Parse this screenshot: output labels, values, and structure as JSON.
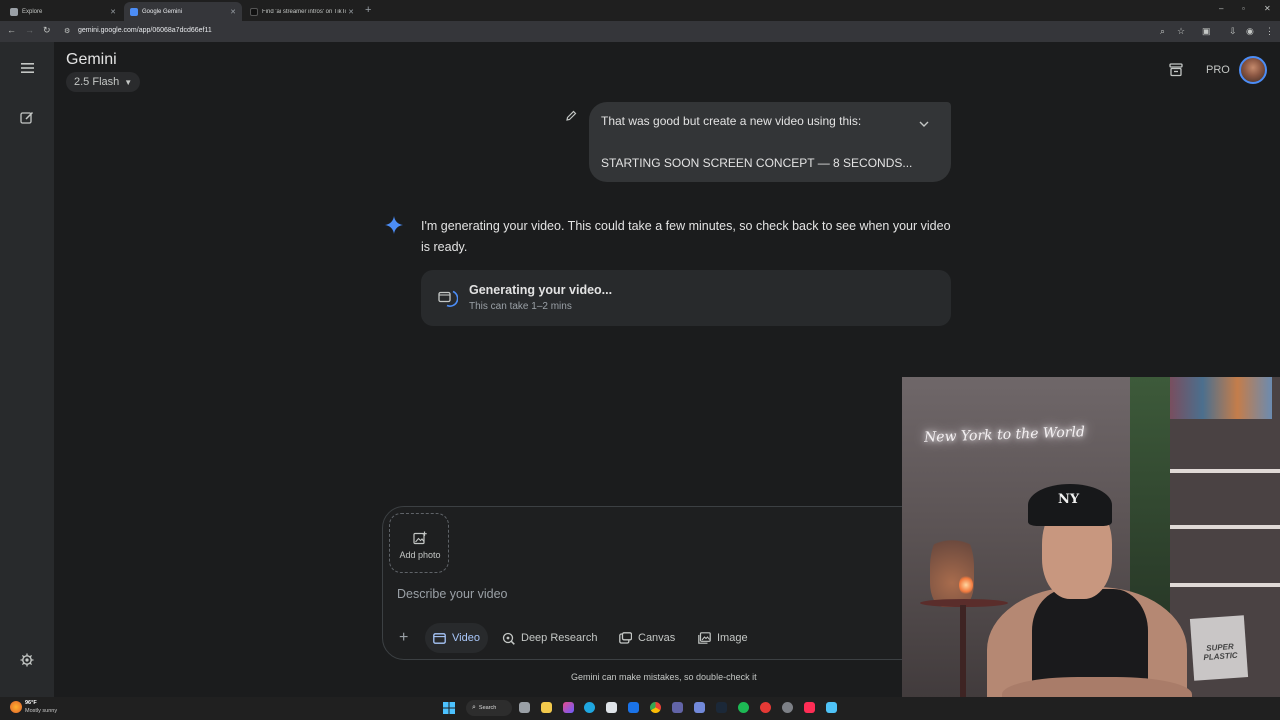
{
  "browser": {
    "tabs": [
      {
        "title": "Explore",
        "active": false
      },
      {
        "title": "Google Gemini",
        "active": true
      },
      {
        "title": "Find 'ai streamer intros' on TikTok",
        "active": false
      }
    ],
    "url": "gemini.google.com/app/06068a7dcd66ef11"
  },
  "header": {
    "title": "Gemini",
    "model": "2.5 Flash",
    "plan_badge": "PRO"
  },
  "conversation": {
    "user_message": {
      "line1": "That was good but create a new video using this:",
      "line2": "STARTING SOON SCREEN CONCEPT — 8 SECONDS..."
    },
    "assistant_message": "I'm generating your video. This could take a few minutes, so check back to see when your video is ready.",
    "generation_card": {
      "title": "Generating your video...",
      "subtitle": "This can take 1–2 mins"
    }
  },
  "composer": {
    "add_photo_label": "Add photo",
    "placeholder": "Describe your video",
    "tools": [
      {
        "label": "Video",
        "active": true
      },
      {
        "label": "Deep Research",
        "active": false
      },
      {
        "label": "Canvas",
        "active": false
      },
      {
        "label": "Image",
        "active": false
      }
    ]
  },
  "footer": {
    "disclaimer": "Gemini can make mistakes, so double-check it"
  },
  "webcam": {
    "neon_sign": "New York to the World",
    "cap_logo": "NY",
    "box_text": "SUPER PLASTIC"
  },
  "taskbar": {
    "weather_temp": "96°F",
    "weather_desc": "Mostly sunny",
    "search_label": "Search"
  },
  "colors": {
    "accent": "#a8c7fa",
    "gemini_spark": "#4c8df6",
    "background": "#1b1c1d"
  }
}
